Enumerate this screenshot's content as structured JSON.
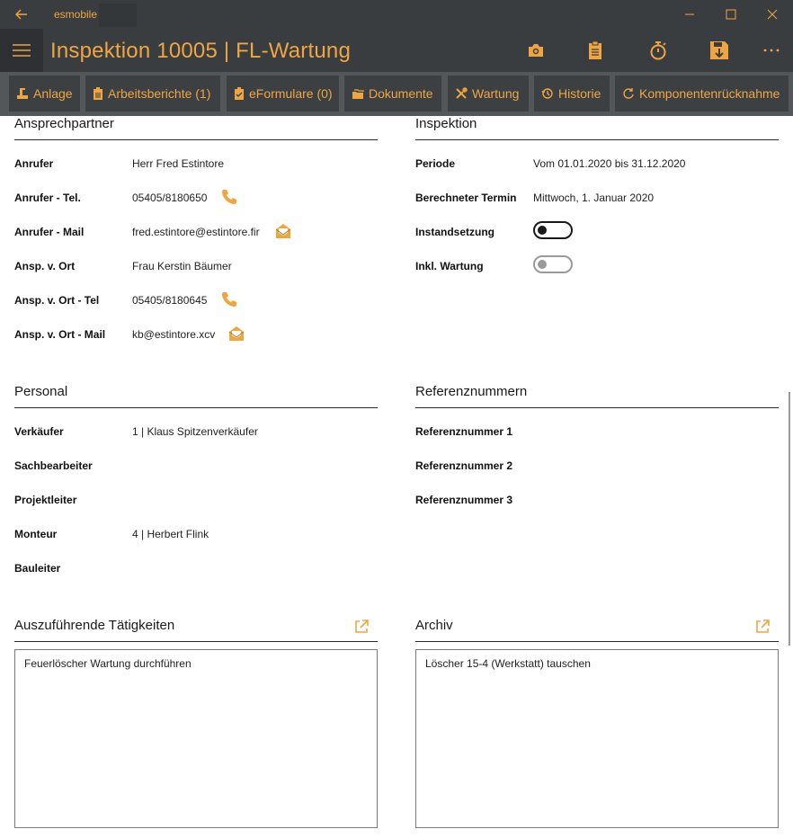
{
  "window": {
    "app_name": "esmobile"
  },
  "header": {
    "title": "Inspektion 10005  |  FL-Wartung"
  },
  "tabs": [
    {
      "label": "Anlage"
    },
    {
      "label": "Arbeitsberichte (1)"
    },
    {
      "label": "eFormulare (0)"
    },
    {
      "label": "Dokumente"
    },
    {
      "label": "Wartung"
    },
    {
      "label": "Historie"
    },
    {
      "label": "Komponentenrücknahme"
    }
  ],
  "ansprechpartner": {
    "title": "Ansprechpartner",
    "rows": [
      {
        "label": "Anrufer",
        "value": "Herr Fred Estintore"
      },
      {
        "label": "Anrufer - Tel.",
        "value": "05405/8180650"
      },
      {
        "label": "Anrufer - Mail",
        "value": "fred.estintore@estintore.fir"
      },
      {
        "label": "Ansp. v. Ort",
        "value": "Frau Kerstin Bäumer"
      },
      {
        "label": "Ansp. v. Ort - Tel",
        "value": "05405/8180645"
      },
      {
        "label": "Ansp. v. Ort - Mail",
        "value": "kb@estintore.xcv"
      }
    ]
  },
  "inspektion": {
    "title": "Inspektion",
    "rows": [
      {
        "label": "Periode",
        "value": "Vom 01.01.2020 bis 31.12.2020"
      },
      {
        "label": "Berechneter Termin",
        "value": "Mittwoch, 1. Januar 2020"
      },
      {
        "label": "Instandsetzung",
        "toggle": "off"
      },
      {
        "label": "Inkl. Wartung",
        "toggle": "off-disabled"
      }
    ]
  },
  "personal": {
    "title": "Personal",
    "rows": [
      {
        "label": "Verkäufer",
        "value": "1  |  Klaus Spitzenverkäufer"
      },
      {
        "label": "Sachbearbeiter",
        "value": ""
      },
      {
        "label": "Projektleiter",
        "value": ""
      },
      {
        "label": "Monteur",
        "value": "4  |  Herbert Flink"
      },
      {
        "label": "Bauleiter",
        "value": ""
      }
    ]
  },
  "referenznummern": {
    "title": "Referenznummern",
    "rows": [
      {
        "label": "Referenznummer 1"
      },
      {
        "label": "Referenznummer 2"
      },
      {
        "label": "Referenznummer 3"
      }
    ]
  },
  "taetigkeiten": {
    "title": "Auszuführende Tätigkeiten",
    "text": "Feuerlöscher Wartung durchführen"
  },
  "archiv": {
    "title": "Archiv",
    "text": "Löscher 15-4 (Werkstatt) tauschen"
  },
  "colors": {
    "accent": "#f0a640",
    "chrome": "#3a3d40",
    "tabbar": "#54575a",
    "tab": "#3d4043"
  },
  "icons": {
    "phone": "phone-icon",
    "mail": "mail-open-icon",
    "external": "open-external-icon"
  }
}
